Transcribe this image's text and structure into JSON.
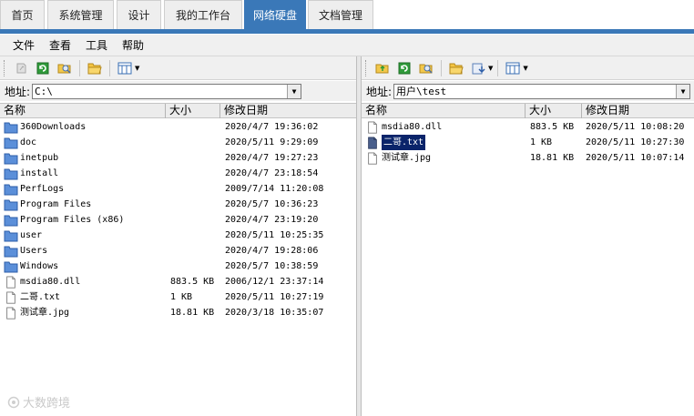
{
  "tabs": [
    {
      "label": "首页"
    },
    {
      "label": "系统管理"
    },
    {
      "label": "设计"
    },
    {
      "label": "我的工作台"
    },
    {
      "label": "网络硬盘"
    },
    {
      "label": "文档管理"
    }
  ],
  "active_tab": "网络硬盘",
  "menu": [
    "文件",
    "查看",
    "工具",
    "帮助"
  ],
  "left_pane": {
    "address_label": "地址:",
    "address_value": "C:\\",
    "columns": {
      "name": "名称",
      "size": "大小",
      "date": "修改日期"
    },
    "rows": [
      {
        "name": "360Downloads",
        "size": "",
        "date": "2020/4/7 19:36:02",
        "icon": "folder-icon"
      },
      {
        "name": "doc",
        "size": "",
        "date": "2020/5/11 9:29:09",
        "icon": "folder-icon"
      },
      {
        "name": "inetpub",
        "size": "",
        "date": "2020/4/7 19:27:23",
        "icon": "folder-icon"
      },
      {
        "name": "install",
        "size": "",
        "date": "2020/4/7 23:18:54",
        "icon": "folder-icon"
      },
      {
        "name": "PerfLogs",
        "size": "",
        "date": "2009/7/14 11:20:08",
        "icon": "folder-icon"
      },
      {
        "name": "Program Files",
        "size": "",
        "date": "2020/5/7 10:36:23",
        "icon": "folder-icon"
      },
      {
        "name": "Program Files (x86)",
        "size": "",
        "date": "2020/4/7 23:19:20",
        "icon": "folder-icon"
      },
      {
        "name": "user",
        "size": "",
        "date": "2020/5/11 10:25:35",
        "icon": "folder-icon"
      },
      {
        "name": "Users",
        "size": "",
        "date": "2020/4/7 19:28:06",
        "icon": "folder-icon"
      },
      {
        "name": "Windows",
        "size": "",
        "date": "2020/5/7 10:38:59",
        "icon": "folder-icon"
      },
      {
        "name": "msdia80.dll",
        "size": "883.5 KB",
        "date": "2006/12/1 23:37:14",
        "icon": "file-icon"
      },
      {
        "name": "二哥.txt",
        "size": "1 KB",
        "date": "2020/5/11 10:27:19",
        "icon": "file-icon"
      },
      {
        "name": "测试章.jpg",
        "size": "18.81 KB",
        "date": "2020/3/18 10:35:07",
        "icon": "file-icon"
      }
    ]
  },
  "right_pane": {
    "address_label": "地址:",
    "address_value": "用户\\test",
    "columns": {
      "name": "名称",
      "size": "大小",
      "date": "修改日期"
    },
    "rows": [
      {
        "name": "msdia80.dll",
        "size": "883.5 KB",
        "date": "2020/5/11 10:08:20",
        "icon": "file-icon"
      },
      {
        "name": "二哥.txt",
        "size": "1 KB",
        "date": "2020/5/11 10:27:30",
        "icon": "file-icon",
        "selected": true
      },
      {
        "name": "测试章.jpg",
        "size": "18.81 KB",
        "date": "2020/5/11 10:07:14",
        "icon": "file-icon"
      }
    ]
  },
  "watermark": "大数跨境",
  "colors": {
    "accent": "#3a78b8",
    "selection": "#0a246a",
    "folder": "#5b8fd9"
  }
}
